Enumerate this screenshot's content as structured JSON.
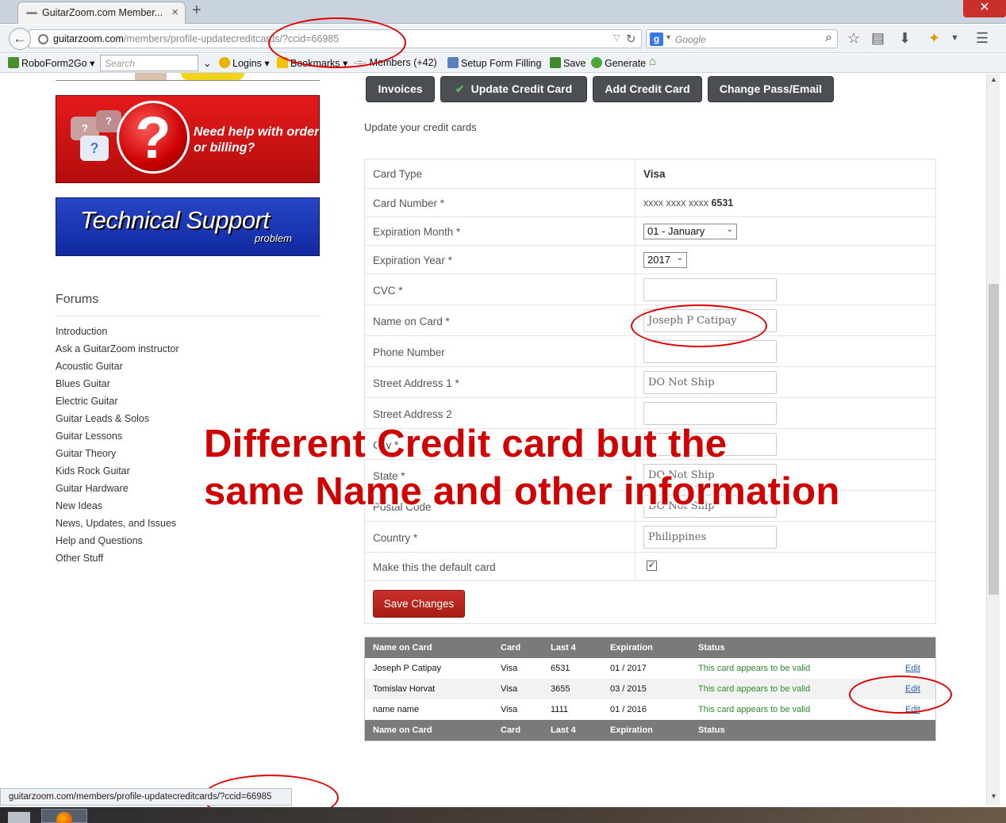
{
  "browser": {
    "tab_title": "GuitarZoom.com Member...",
    "new_tab": "+",
    "close_window": "✕",
    "url_host": "guitarzoom.com",
    "url_path": "/members/profile-updatecreditcards/?ccid=66985",
    "search_placeholder": "Google"
  },
  "bookmarks": {
    "roboform": "RoboForm2Go",
    "search_placeholder": "Search",
    "logins": "Logins",
    "bookmarks": "Bookmarks",
    "members": "Members  (+42)",
    "setup": "Setup Form Filling",
    "save": "Save",
    "generate": "Generate"
  },
  "sidebar": {
    "help_banner": "Need help with order or billing?",
    "tech_title": "Technical Support",
    "tech_sub": "problem",
    "forums_heading": "Forums",
    "forums": [
      "Introduction",
      "Ask a GuitarZoom instructor",
      "Acoustic Guitar",
      "Blues Guitar",
      "Electric Guitar",
      "Guitar Leads & Solos",
      "Guitar Lessons",
      "Guitar Theory",
      "Kids Rock Guitar",
      "Guitar Hardware",
      "New Ideas",
      "News, Updates, and Issues",
      "Help and Questions",
      "Other Stuff"
    ]
  },
  "tabs": {
    "invoices": "Invoices",
    "update": "Update Credit Card",
    "add": "Add Credit Card",
    "change": "Change Pass/Email"
  },
  "intro": "Update your credit cards",
  "form": {
    "card_type_label": "Card Type",
    "card_type_value": "Visa",
    "card_number_label": "Card Number *",
    "card_number_mask": "xxxx xxxx xxxx",
    "card_number_last4": "6531",
    "exp_month_label": "Expiration Month *",
    "exp_month_value": "01 - January",
    "exp_year_label": "Expiration Year *",
    "exp_year_value": "2017",
    "cvc_label": "CVC *",
    "cvc_value": "",
    "name_label": "Name on Card *",
    "name_value": "Joseph P Catipay",
    "phone_label": "Phone Number",
    "phone_value": "",
    "street1_label": "Street Address 1 *",
    "street1_value": "DO Not Ship",
    "street2_label": "Street Address 2",
    "street2_value": "",
    "city_label": "City *",
    "city_value": "",
    "state_label": "State *",
    "state_value": "DO Not Ship",
    "postal_label": "Postal Code",
    "postal_value": "DO Not Ship",
    "country_label": "Country *",
    "country_value": "Philippines",
    "default_label": "Make this the default card",
    "default_checked": "✓",
    "save_label": "Save Changes"
  },
  "cards_table": {
    "headers": [
      "Name on Card",
      "Card",
      "Last 4",
      "Expiration",
      "Status"
    ],
    "rows": [
      {
        "name": "Joseph P Catipay",
        "card": "Visa",
        "last4": "6531",
        "exp": "01 / 2017",
        "status": "This card appears to be valid",
        "action": "Edit"
      },
      {
        "name": "Tomislav Horvat",
        "card": "Visa",
        "last4": "3655",
        "exp": "03 / 2015",
        "status": "This card appears to be valid",
        "action": "Edit"
      },
      {
        "name": "name name",
        "card": "Visa",
        "last4": "1111",
        "exp": "01 / 2016",
        "status": "This card appears to be valid",
        "action": "Edit"
      }
    ]
  },
  "annotation": {
    "line1": "Different Credit card but the",
    "line2": "same Name and other information",
    "ring_color": "#e00000",
    "text_color": "#d00000"
  },
  "status_bar": "guitarzoom.com/members/profile-updatecreditcards/?ccid=66985"
}
